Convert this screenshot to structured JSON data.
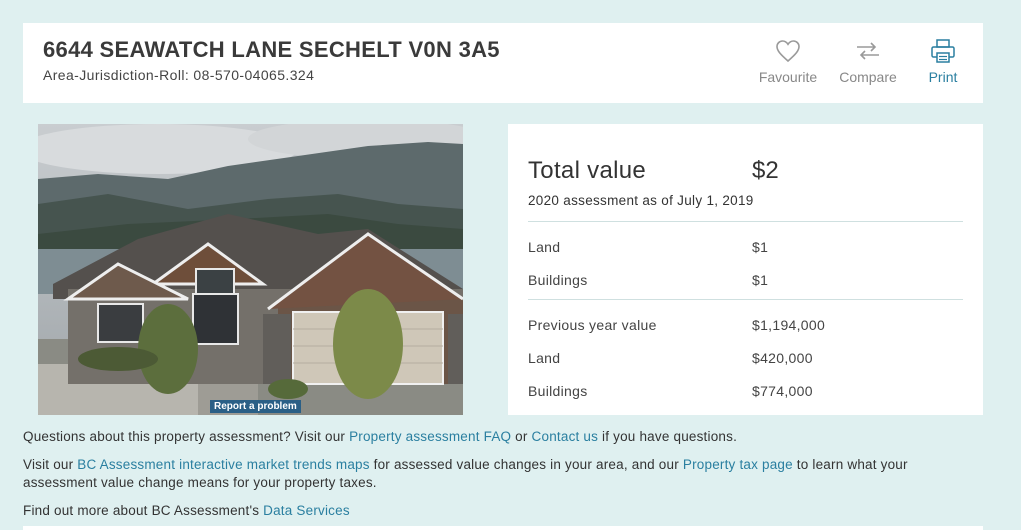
{
  "header": {
    "address": "6644 SEAWATCH LANE SECHELT V0N 3A5",
    "roll": "Area-Jurisdiction-Roll: 08-570-04065.324",
    "actions": {
      "favourite": "Favourite",
      "compare": "Compare",
      "print": "Print"
    }
  },
  "photo": {
    "report_label": "Report a problem"
  },
  "values": {
    "total_label": "Total value",
    "total_value": "$2",
    "as_of": "2020 assessment as of July 1, 2019",
    "current": [
      {
        "label": "Land",
        "value": "$1"
      },
      {
        "label": "Buildings",
        "value": "$1"
      }
    ],
    "previous": [
      {
        "label": "Previous year value",
        "value": "$1,194,000"
      },
      {
        "label": "Land",
        "value": "$420,000"
      },
      {
        "label": "Buildings",
        "value": "$774,000"
      }
    ]
  },
  "info": {
    "line1_a": "Questions about this property assessment? Visit our ",
    "line1_link1": "Property assessment FAQ",
    "line1_b": " or ",
    "line1_link2": "Contact us",
    "line1_c": " if you have questions.",
    "line2_a": "Visit our ",
    "line2_link1": "BC Assessment interactive market trends maps",
    "line2_b": " for assessed value changes in your area, and our ",
    "line2_link2": "Property tax page",
    "line2_c": " to learn what your assessment value change means for your property taxes.",
    "line3_a": "Find out more about BC Assessment's ",
    "line3_link": "Data Services"
  },
  "colors": {
    "background": "#dff0f0",
    "link": "#2a7fa0",
    "report_button": "#2a5f86"
  }
}
